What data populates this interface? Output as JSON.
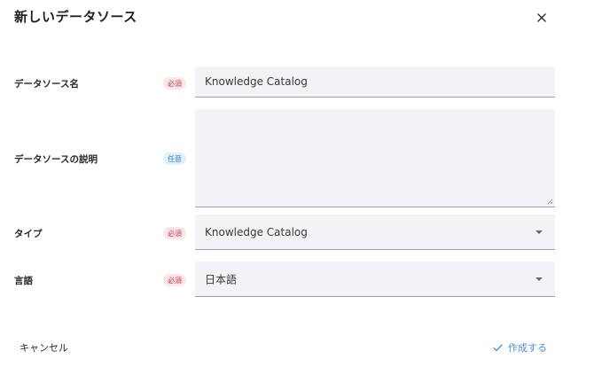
{
  "dialog": {
    "title": "新しいデータソース",
    "close_icon": "close-icon"
  },
  "fields": {
    "name": {
      "label": "データソース名",
      "badge": "必須",
      "value": "Knowledge Catalog"
    },
    "description": {
      "label": "データソースの説明",
      "badge": "任意",
      "value": ""
    },
    "type": {
      "label": "タイプ",
      "badge": "必須",
      "value": "Knowledge Catalog",
      "icon": "chevron-down-icon"
    },
    "language": {
      "label": "言語",
      "badge": "必須",
      "value": "日本語",
      "icon": "chevron-down-icon"
    }
  },
  "footer": {
    "cancel_label": "キャンセル",
    "create_label": "作成する",
    "create_icon": "check-icon"
  },
  "colors": {
    "required_badge_bg": "#fde6ea",
    "required_badge_text": "#c53a4f",
    "optional_badge_bg": "#e2f0fc",
    "optional_badge_text": "#2a7dc4",
    "field_bg": "#f1f3f6",
    "accent": "#4a8fd6"
  }
}
